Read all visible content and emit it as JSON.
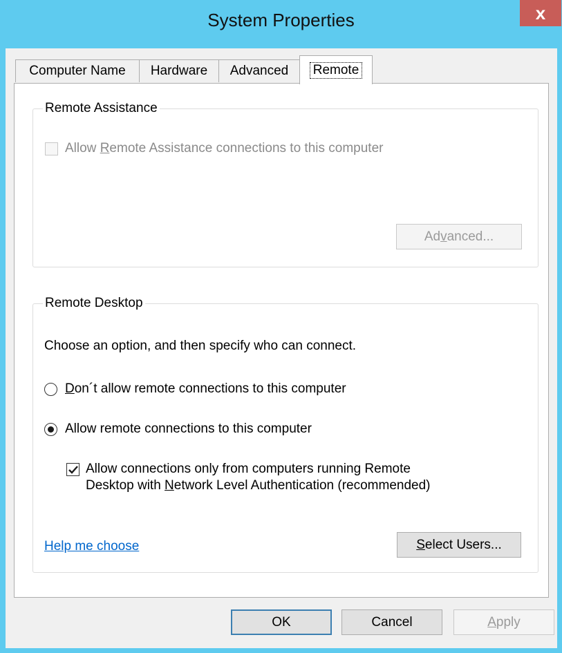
{
  "window": {
    "title": "System Properties",
    "close_glyph": "x"
  },
  "tabs": [
    {
      "label": "Computer Name",
      "active": false
    },
    {
      "label": "Hardware",
      "active": false
    },
    {
      "label": "Advanced",
      "active": false
    },
    {
      "label": "Remote",
      "active": true
    }
  ],
  "remote_assistance": {
    "legend": "Remote Assistance",
    "allow_checkbox": {
      "pre": "Allow ",
      "mnemonic": "R",
      "post": "emote Assistance connections to this computer",
      "checked": false,
      "enabled": false
    },
    "advanced_button": {
      "pre": "Ad",
      "mnemonic": "v",
      "post": "anced...",
      "enabled": false
    }
  },
  "remote_desktop": {
    "legend": "Remote Desktop",
    "instruction": "Choose an option, and then specify who can connect.",
    "option_dont_allow": {
      "mnemonic": "D",
      "post": "on´t allow remote connections to this computer",
      "selected": false
    },
    "option_allow": {
      "label": "Allow remote connections to this computer",
      "selected": true
    },
    "nla_checkbox": {
      "line1": "Allow connections only from computers running Remote",
      "line2_pre": "Desktop with ",
      "line2_mnemonic": "N",
      "line2_post": "etwork Level Authentication (recommended)",
      "checked": true
    },
    "help_link": "Help me choose",
    "select_users_button": {
      "mnemonic": "S",
      "post": "elect Users..."
    }
  },
  "footer": {
    "ok_label": "OK",
    "cancel_label": "Cancel",
    "apply": {
      "mnemonic": "A",
      "post": "pply",
      "enabled": false
    }
  },
  "colors": {
    "titlebar": "#5ecbef",
    "close_button": "#c85d58",
    "link": "#0066cc",
    "client_background": "#f0f0f0"
  },
  "icons": {
    "close": "close-icon",
    "checkmark": "checkmark-icon"
  }
}
